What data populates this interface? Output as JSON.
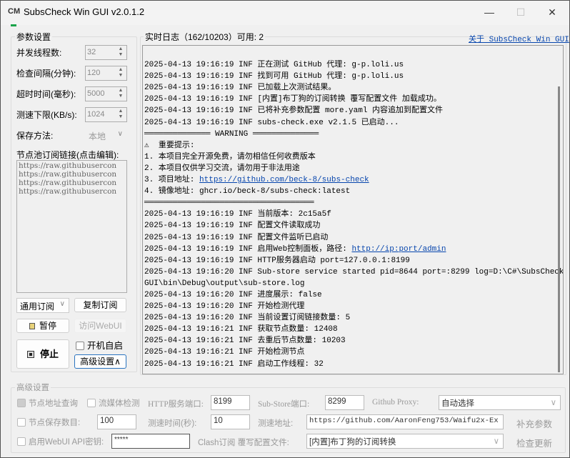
{
  "window": {
    "logo": "CM",
    "title": "SubsCheck Win GUI v2.0.1.2",
    "minimize": "—",
    "maximize": "☐",
    "close": "✕"
  },
  "params": {
    "group_title": "参数设置",
    "threads": {
      "label": "并发线程数:",
      "value": "32"
    },
    "interval": {
      "label": "检查间隔(分钟):",
      "value": "120"
    },
    "timeout": {
      "label": "超时时间(毫秒):",
      "value": "5000"
    },
    "speed_min": {
      "label": "测速下限(KB/s):",
      "value": "1024"
    },
    "save_method": {
      "label": "保存方法:",
      "value": "本地"
    },
    "sub_links_label": "节点池订阅链接(点击编辑):",
    "sub_links": [
      "https://raw.githubusercon",
      "https://raw.githubusercon",
      "https://raw.githubusercon",
      "https://raw.githubusercon"
    ],
    "sub_type": "通用订阅",
    "copy_sub": "复制订阅",
    "pause": "暂停",
    "visit_webui": "访问WebUI",
    "stop": "停止",
    "autostart": "开机自启",
    "advanced": "高级设置∧"
  },
  "log": {
    "title": "实时日志（162/10203）可用: 2",
    "about_link": "关于 SubsCheck Win GUI",
    "lines_top": [
      "2025-04-13 19:16:19 INF 正在测试 GitHub 代理: g-p.loli.us",
      "2025-04-13 19:16:19 INF 找到可用 GitHub 代理: g-p.loli.us",
      "2025-04-13 19:16:19 INF 已加载上次测试结果。",
      "2025-04-13 19:16:19 INF [内置]布丁狗的订阅转换 覆写配置文件 加载成功。",
      "2025-04-13 19:16:19 INF 已将补充参数配置 more.yaml 内容追加到配置文件",
      "2025-04-13 19:16:19 INF subs-check.exe v2.1.5 已启动..."
    ],
    "warning_bar": "══════════════ WARNING ══════════════",
    "notice_title": "⚠  重要提示:",
    "notice1": "1. 本项目完全开源免费，请勿相信任何收费版本",
    "notice2": "2. 本项目仅供学习交流，请勿用于非法用途",
    "notice3_label": "3. 项目地址: ",
    "notice3_link": "https://github.com/beck-8/subs-check",
    "notice4": "4. 镜像地址: ghcr.io/beck-8/subs-check:latest",
    "end_bar": "════════════════════════════════════",
    "webpanel_prefix": "2025-04-13 19:16:19 INF 启用Web控制面板，路径: ",
    "webpanel_link": "http://ip:port/admin",
    "lines_mid": [
      "2025-04-13 19:16:19 INF 当前版本: 2c15a5f",
      "2025-04-13 19:16:19 INF 配置文件读取成功",
      "2025-04-13 19:16:19 INF 配置文件监听已启动"
    ],
    "lines_bottom": [
      "2025-04-13 19:16:19 INF HTTP服务器启动 port=127.0.0.1:8199",
      "2025-04-13 19:16:20 INF Sub-store service started pid=8644 port=:8299 log=D:\\C#\\SubsCheck-Win-",
      "GUI\\bin\\Debug\\output\\sub-store.log",
      "2025-04-13 19:16:20 INF 进度展示: false",
      "2025-04-13 19:16:20 INF 开始检测代理",
      "2025-04-13 19:16:20 INF 当前设置订阅链接数量: 5",
      "2025-04-13 19:16:21 INF 获取节点数量: 12408",
      "2025-04-13 19:16:21 INF 去重后节点数量: 10203",
      "2025-04-13 19:16:21 INF 开始检测节点",
      "2025-04-13 19:16:21 INF 启动工作线程: 32"
    ]
  },
  "advanced": {
    "group_title": "高级设置",
    "node_addr_query": "节点地址查询",
    "stream_check": "流媒体检测",
    "http_port_label": "HTTP服务端口:",
    "http_port": "8199",
    "substore_port_label": "Sub-Store端口:",
    "substore_port": "8299",
    "github_proxy_label": "Github Proxy:",
    "github_proxy": "自动选择",
    "node_save_count": "节点保存数目:",
    "node_save_value": "100",
    "speed_time_label": "测速时间(秒):",
    "speed_time": "10",
    "speed_url_label": "测速地址:",
    "speed_url": "https://github.com/AaronFeng753/Waifu2x-Ex",
    "extra_params": "补充参数",
    "webui_key_label": "启用WebUI API密钥:",
    "webui_key": "*****",
    "clash_label": "Clash订阅 覆写配置文件:",
    "clash_value": "[内置]布丁狗的订阅转换",
    "check_update": "检查更新"
  }
}
